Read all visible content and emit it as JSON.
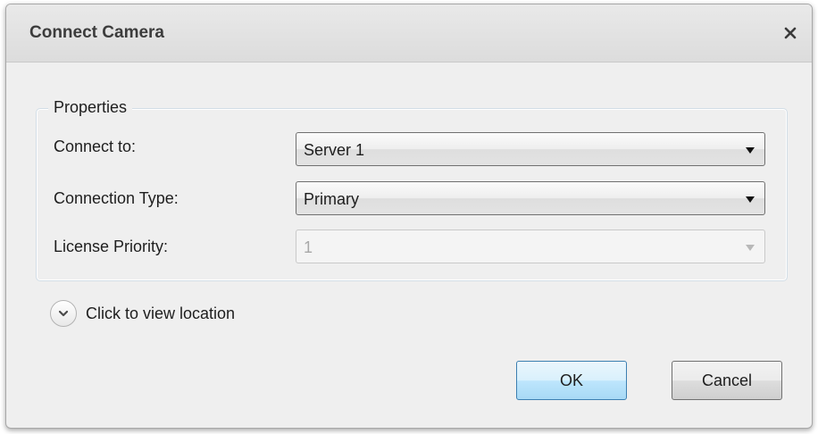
{
  "dialog": {
    "title": "Connect Camera",
    "close_icon": "close-icon"
  },
  "properties": {
    "legend": "Properties",
    "connect_to": {
      "label": "Connect to:",
      "value": "Server 1",
      "enabled": true
    },
    "connection_type": {
      "label": "Connection Type:",
      "value": "Primary",
      "enabled": true
    },
    "license_priority": {
      "label": "License Priority:",
      "value": "1",
      "enabled": false
    }
  },
  "location_expander": {
    "icon": "chevron-down-icon",
    "label": "Click to view location"
  },
  "buttons": {
    "ok_label": "OK",
    "cancel_label": "Cancel"
  },
  "colors": {
    "ok_border": "#3c7fb1",
    "ok_fill": "#bee6fd",
    "disabled_text": "#a8a8a8"
  }
}
